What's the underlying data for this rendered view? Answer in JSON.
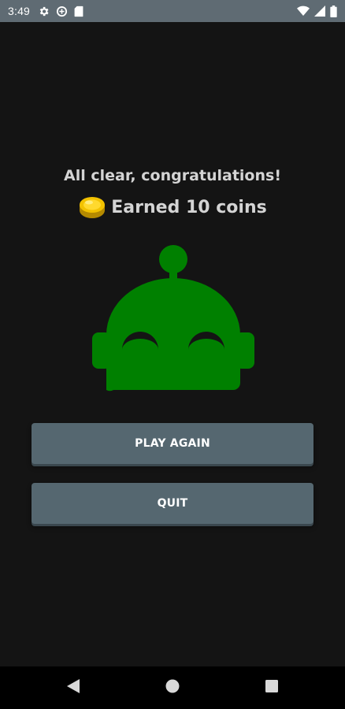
{
  "status_bar": {
    "time": "3:49",
    "left_icons": [
      "gear-icon",
      "data-saver-icon",
      "sd-card-icon"
    ],
    "right_icons": [
      "wifi-icon",
      "signal-icon",
      "battery-icon"
    ]
  },
  "result": {
    "headline": "All clear, congratulations!",
    "reward_text": "Earned 10 coins",
    "coin_icon": "coin-icon"
  },
  "mascot": {
    "icon": "robot-icon",
    "color": "#008000"
  },
  "buttons": {
    "play_again": "PLAY AGAIN",
    "quit": "QUIT"
  },
  "nav_bar": {
    "buttons": [
      "back-icon",
      "home-icon",
      "recents-icon"
    ]
  },
  "colors": {
    "background": "#141414",
    "button": "#556770",
    "text": "#d4d4d4",
    "status_bar": "#5f6b73"
  }
}
